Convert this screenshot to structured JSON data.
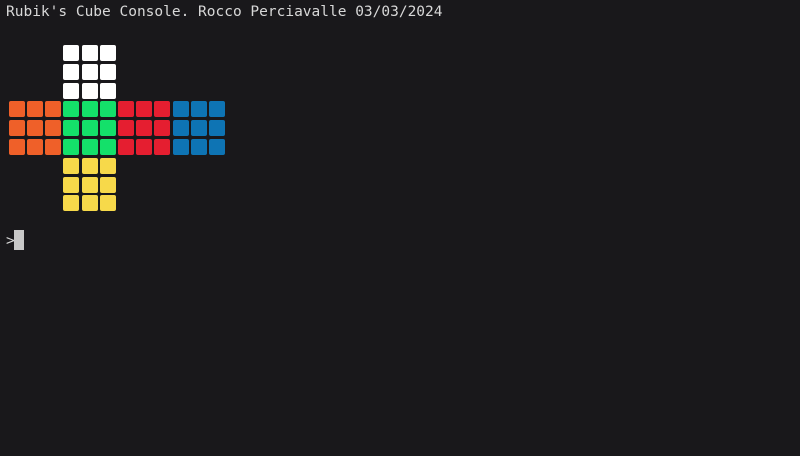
{
  "console": {
    "title": "Rubik's Cube Console. Rocco Perciavalle 03/03/2024",
    "prompt": ">",
    "input": ""
  },
  "colors": {
    "W": "#ffffff",
    "O": "#ef6029",
    "G": "#14e06a",
    "R": "#e51e30",
    "B": "#0e74b4",
    "Y": "#f7d94a",
    "background": "#19181b",
    "text": "#d8d8d8",
    "cursor": "#c8c8c8"
  },
  "cube": {
    "up": [
      [
        "W",
        "W",
        "W"
      ],
      [
        "W",
        "W",
        "W"
      ],
      [
        "W",
        "W",
        "W"
      ]
    ],
    "left": [
      [
        "O",
        "O",
        "O"
      ],
      [
        "O",
        "O",
        "O"
      ],
      [
        "O",
        "O",
        "O"
      ]
    ],
    "front": [
      [
        "G",
        "G",
        "G"
      ],
      [
        "G",
        "G",
        "G"
      ],
      [
        "G",
        "G",
        "G"
      ]
    ],
    "right": [
      [
        "R",
        "R",
        "R"
      ],
      [
        "R",
        "R",
        "R"
      ],
      [
        "R",
        "R",
        "R"
      ]
    ],
    "back": [
      [
        "B",
        "B",
        "B"
      ],
      [
        "B",
        "B",
        "B"
      ],
      [
        "B",
        "B",
        "B"
      ]
    ],
    "down": [
      [
        "Y",
        "Y",
        "Y"
      ],
      [
        "Y",
        "Y",
        "Y"
      ],
      [
        "Y",
        "Y",
        "Y"
      ]
    ]
  }
}
